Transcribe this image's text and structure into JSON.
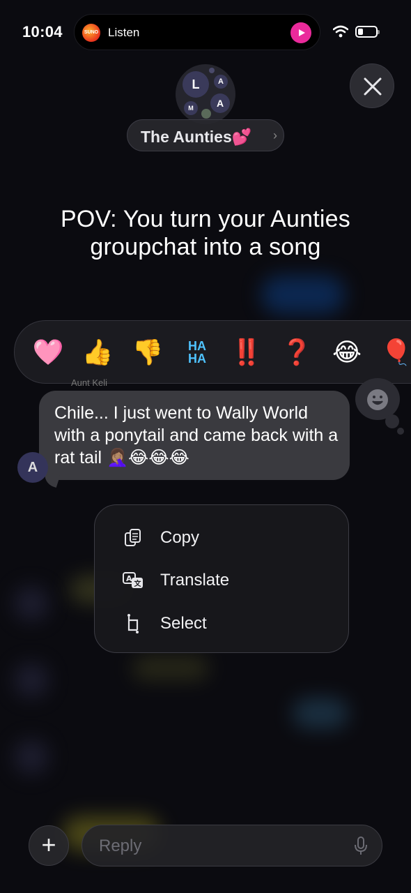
{
  "status": {
    "time": "10:04",
    "live_activity_app": "SUNO",
    "live_activity_label": "Listen"
  },
  "header": {
    "chat_name": "The Aunties💕",
    "avatars": [
      "L",
      "A",
      "M",
      "A"
    ]
  },
  "overlay": {
    "caption_line1": "POV: You turn your Aunties",
    "caption_line2": "groupchat into a song"
  },
  "tapbacks": [
    {
      "name": "heart",
      "glyph": "🩷"
    },
    {
      "name": "thumbs-up",
      "glyph": "👍"
    },
    {
      "name": "thumbs-down",
      "glyph": "👎"
    },
    {
      "name": "haha",
      "glyph": "HA HA"
    },
    {
      "name": "exclamation",
      "glyph": "‼️"
    },
    {
      "name": "question",
      "glyph": "❓"
    },
    {
      "name": "laughing",
      "glyph": "😂"
    },
    {
      "name": "balloon",
      "glyph": "🎈"
    }
  ],
  "message": {
    "sender": "Aunt Keli",
    "sender_initial": "A",
    "text": "Chile... I just went to Wally World with a ponytail and came back with a rat tail 🤦🏽‍♀️😂😂😂"
  },
  "context_menu": {
    "items": [
      {
        "label": "Copy",
        "icon": "copy-icon"
      },
      {
        "label": "Translate",
        "icon": "translate-icon"
      },
      {
        "label": "Select",
        "icon": "select-icon"
      }
    ]
  },
  "composer": {
    "add_label": "+",
    "reply_placeholder": "Reply"
  },
  "colors": {
    "background": "#0b0b10",
    "bubble": "#3a3a3f",
    "play_accent": "#ea2a9b"
  }
}
